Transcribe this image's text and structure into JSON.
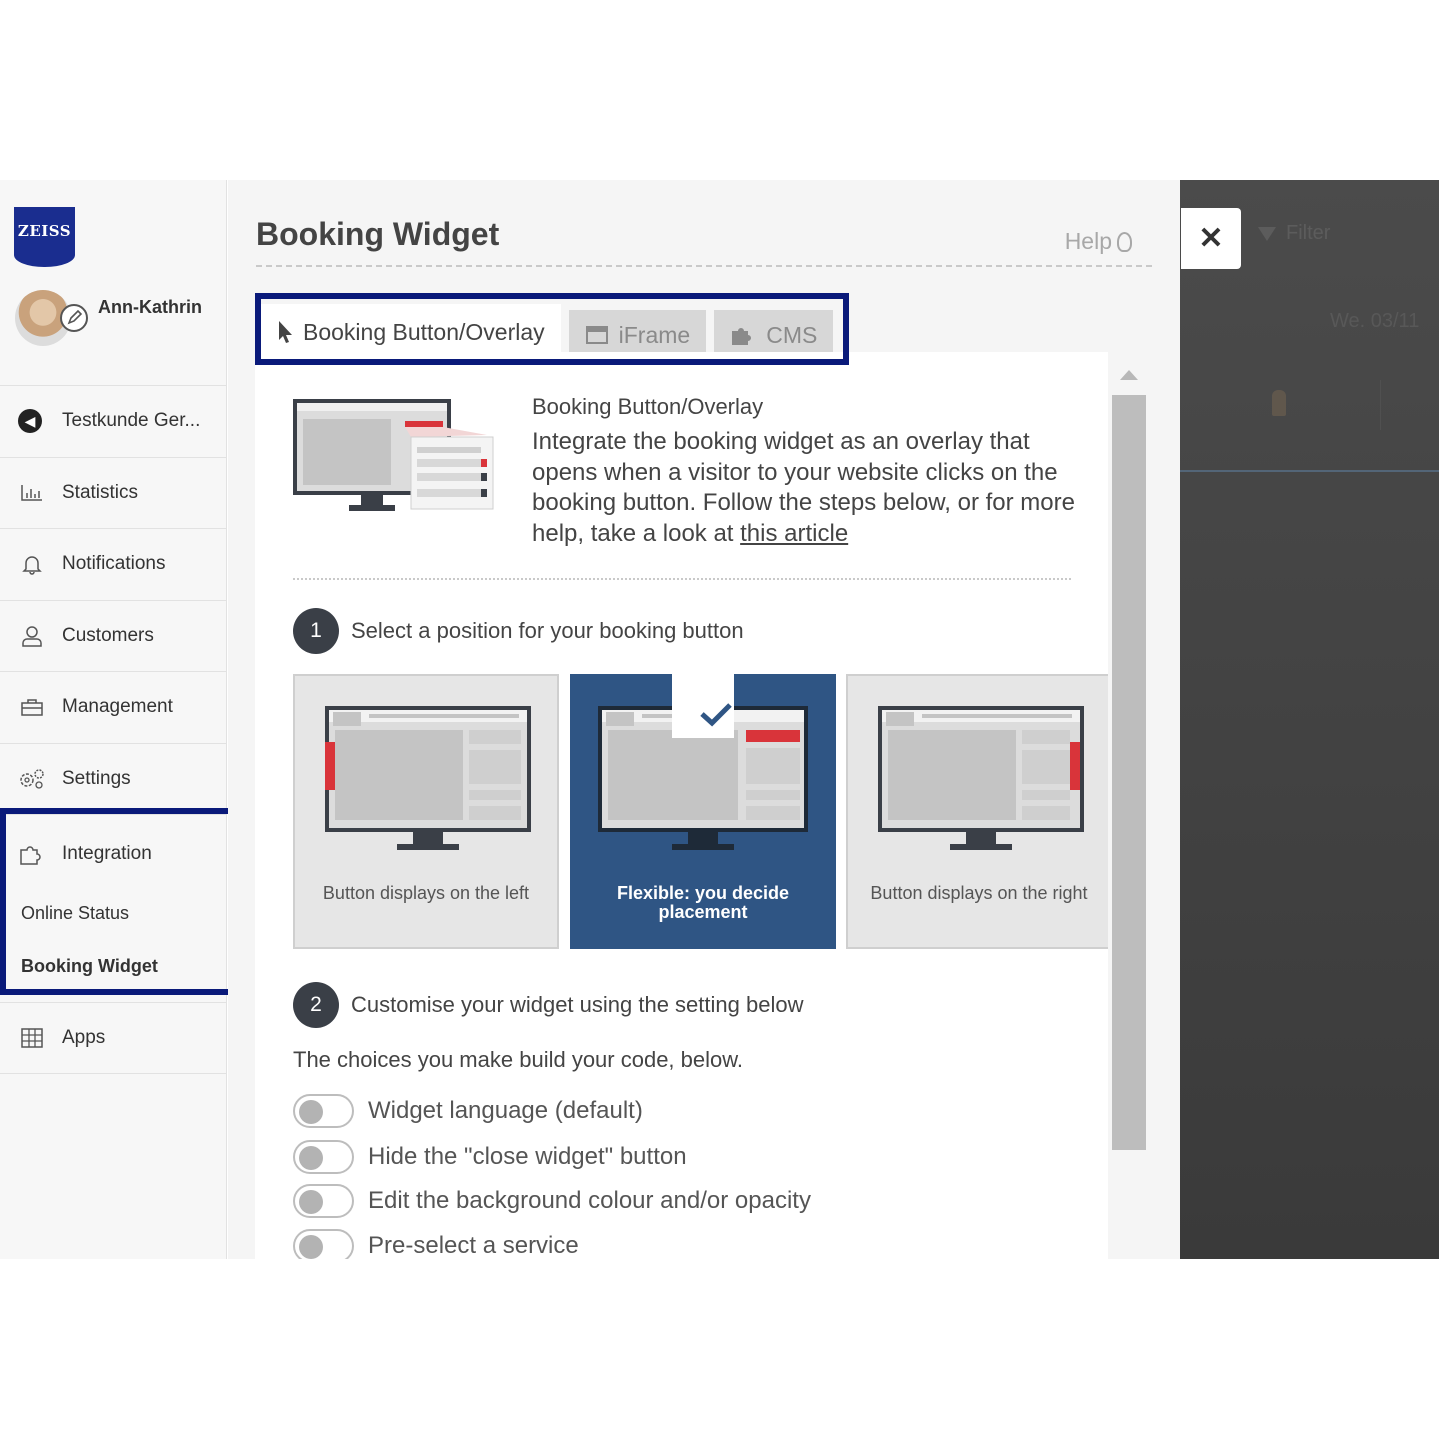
{
  "brand": {
    "logo_text": "ZEISS",
    "logo_color": "#1a2d8f"
  },
  "user": {
    "name": "Ann-Kathrin"
  },
  "sidebar": {
    "items": [
      {
        "label": "Testkunde Ger...",
        "icon": "back-arrow-icon"
      },
      {
        "label": "Statistics",
        "icon": "bar-chart-icon"
      },
      {
        "label": "Notifications",
        "icon": "bell-icon"
      },
      {
        "label": "Customers",
        "icon": "person-icon"
      },
      {
        "label": "Management",
        "icon": "briefcase-icon"
      },
      {
        "label": "Settings",
        "icon": "gears-icon"
      },
      {
        "label": "Integration",
        "icon": "puzzle-icon"
      },
      {
        "label": "Apps",
        "icon": "grid-icon"
      }
    ],
    "sub_items": [
      {
        "label": "Online Status"
      },
      {
        "label": "Booking Widget"
      }
    ]
  },
  "main": {
    "title": "Booking Widget",
    "help_label": "Help",
    "tabs": [
      {
        "label": "Booking Button/Overlay",
        "icon": "cursor-icon",
        "active": true
      },
      {
        "label": "iFrame",
        "icon": "window-icon",
        "active": false
      },
      {
        "label": "CMS",
        "icon": "puzzle-icon",
        "active": false
      }
    ],
    "intro": {
      "heading": "Booking Button/Overlay",
      "text": "Integrate the booking widget as an overlay that opens when a visitor to your website clicks on the booking button. Follow the steps below, or for more help, take a look at ",
      "link_text": "this article"
    },
    "step1": {
      "number": "1",
      "label": "Select a position for your booking button"
    },
    "positions": [
      {
        "caption": "Button displays on the left",
        "selected": false
      },
      {
        "caption": "Flexible: you decide placement",
        "selected": true
      },
      {
        "caption": "Button displays on the right",
        "selected": false
      }
    ],
    "step2": {
      "number": "2",
      "label": "Customise your widget using the setting below"
    },
    "code_note": "The choices you make build your code, below.",
    "toggles": [
      {
        "label": "Widget language (default)",
        "on": false
      },
      {
        "label": "Hide the \"close widget\" button",
        "on": false
      },
      {
        "label": "Edit the background colour and/or opacity",
        "on": false
      },
      {
        "label": "Pre-select a service",
        "on": false
      }
    ]
  },
  "overlay": {
    "close_label": "✕",
    "filter_label": "Filter",
    "date_label": "We. 03/11"
  },
  "colors": {
    "accent_blue": "#2f5584",
    "highlight_frame": "#0a1a7a",
    "red": "#d9343a"
  }
}
